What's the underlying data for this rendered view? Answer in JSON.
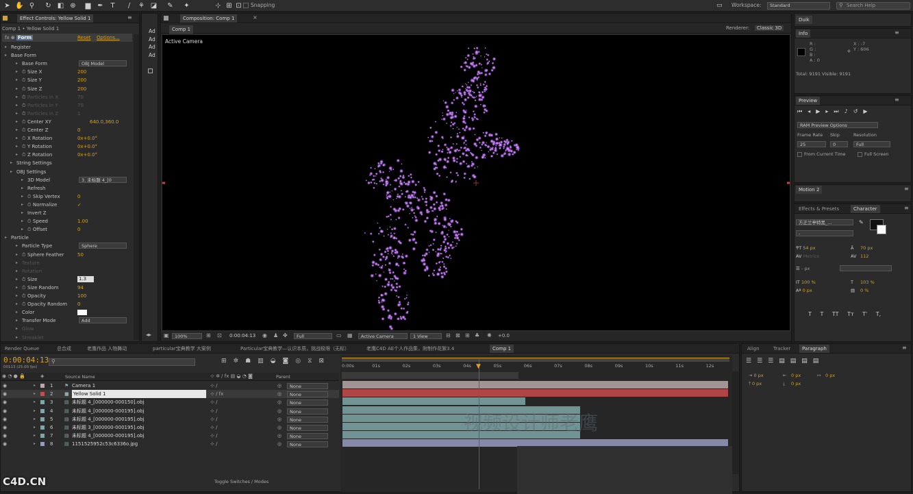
{
  "toolbar": {
    "snapping_label": "Snapping",
    "workspace_label": "Workspace:",
    "workspace_value": "Standard",
    "search_placeholder": "Search Help"
  },
  "effect_controls": {
    "tab_label": "Effect Controls: Yellow Solid 1",
    "breadcrumb": "Comp 1 • Yellow Solid 1",
    "effect_name": "Form",
    "reset_label": "Reset",
    "options_label": "Options...",
    "side_labels": [
      "Ad",
      "Ad",
      "Ad",
      "Ad"
    ],
    "rows": [
      {
        "label": "Register",
        "indent": 1,
        "value": "",
        "dim": false
      },
      {
        "label": "Base Form",
        "indent": 1,
        "value": "",
        "dim": false
      },
      {
        "label": "Base Form",
        "indent": 3,
        "value": "OBJ Model",
        "dd": true,
        "dim": false
      },
      {
        "label": "Size X",
        "indent": 3,
        "value": "200",
        "dim": false
      },
      {
        "label": "Size Y",
        "indent": 3,
        "value": "200",
        "dim": false
      },
      {
        "label": "Size Z",
        "indent": 3,
        "value": "200",
        "dim": false
      },
      {
        "label": "Particles in X",
        "indent": 3,
        "value": "70",
        "dim": true
      },
      {
        "label": "Particles in Y",
        "indent": 3,
        "value": "70",
        "dim": true
      },
      {
        "label": "Particles in Z",
        "indent": 3,
        "value": "1",
        "dim": true
      },
      {
        "label": "Center XY",
        "indent": 3,
        "value": "640.0,360.0",
        "dim": false
      },
      {
        "label": "Center Z",
        "indent": 3,
        "value": "0",
        "dim": false
      },
      {
        "label": "X Rotation",
        "indent": 3,
        "value": "0x+0.0°",
        "dim": false
      },
      {
        "label": "Y Rotation",
        "indent": 3,
        "value": "0x+0.0°",
        "dim": false
      },
      {
        "label": "Z Rotation",
        "indent": 3,
        "value": "0x+0.0°",
        "dim": false
      },
      {
        "label": "String Settings",
        "indent": 2,
        "value": "",
        "dim": false
      },
      {
        "label": "OBJ Settings",
        "indent": 2,
        "value": "",
        "dim": false
      },
      {
        "label": "3D Model",
        "indent": 4,
        "value": "3. 未标题 4_[0",
        "dd": true,
        "dim": false
      },
      {
        "label": "Refresh",
        "indent": 4,
        "value": "",
        "dim": false
      },
      {
        "label": "Skip Vertex",
        "indent": 4,
        "value": "0",
        "dim": false
      },
      {
        "label": "Normalize",
        "indent": 4,
        "value": "✓",
        "dim": false
      },
      {
        "label": "Invert Z",
        "indent": 4,
        "value": "",
        "dim": false
      },
      {
        "label": "Speed",
        "indent": 4,
        "value": "1.00",
        "dim": false
      },
      {
        "label": "Offset",
        "indent": 4,
        "value": "0",
        "dim": false
      },
      {
        "label": "Particle",
        "indent": 1,
        "value": "",
        "dim": false
      },
      {
        "label": "Particle Type",
        "indent": 3,
        "value": "Sphere",
        "dd": true,
        "dim": false
      },
      {
        "label": "Sphere Feather",
        "indent": 3,
        "value": "50",
        "dim": false
      },
      {
        "label": "Texture",
        "indent": 3,
        "value": "",
        "dim": true
      },
      {
        "label": "Rotation",
        "indent": 3,
        "value": "",
        "dim": true
      },
      {
        "label": "Size",
        "indent": 3,
        "value": "1.3",
        "box": true,
        "dim": false
      },
      {
        "label": "Size Random",
        "indent": 3,
        "value": "94",
        "dim": false
      },
      {
        "label": "Opacity",
        "indent": 3,
        "value": "100",
        "dim": false
      },
      {
        "label": "Opacity Random",
        "indent": 3,
        "value": "0",
        "dim": false
      },
      {
        "label": "Color",
        "indent": 3,
        "value": "",
        "swatch": true,
        "dim": false
      },
      {
        "label": "Transfer Mode",
        "indent": 3,
        "value": "Add",
        "dd": true,
        "dim": false
      },
      {
        "label": "Glow",
        "indent": 3,
        "value": "",
        "dim": true
      },
      {
        "label": "Streaklet",
        "indent": 3,
        "value": "",
        "dim": true
      }
    ]
  },
  "composition": {
    "tab_label": "Composition: Comp 1",
    "sub_tab": "Comp 1",
    "renderer_label": "Renderer:",
    "renderer_value": "Classic 3D",
    "view_label": "Active Camera",
    "zoom": "100%",
    "timecode": "0:00:04:13",
    "resolution": "Full",
    "camera": "Active Camera",
    "views": "1 View",
    "exposure": "+0.0"
  },
  "right_panels": {
    "duik_tab": "Duik",
    "info_tab": "Info",
    "info_r": "R :",
    "info_g": "G :",
    "info_b": "B :",
    "info_a": "A : 0",
    "info_x": "X : -7",
    "info_y": "Y : 606",
    "info_total": "Total: 9191   Visible: 9191",
    "preview_tab": "Preview",
    "ram_preview": "RAM Preview Options",
    "frame_rate_label": "Frame Rate",
    "skip_label": "Skip",
    "resolution_label": "Resolution",
    "frame_rate_value": "25",
    "skip_value": "0",
    "resolution_value": "Full",
    "from_current": "From Current Time",
    "full_screen": "Full Screen",
    "motion_tab": "Motion 2",
    "effects_tab": "Effects & Presets",
    "character_tab": "Character",
    "font_value": "方正兰亭特黑_...",
    "font_style": "-",
    "font_size": "54 px",
    "leading": "70 px",
    "kerning": "Metrics",
    "tracking": "112",
    "stroke_width": "- px",
    "vscale": "100 %",
    "hscale": "103 %",
    "baseline": "0 px",
    "tsume": "0 %",
    "text_buttons": [
      "T",
      "T",
      "TT",
      "Tт",
      "T'",
      "T,"
    ]
  },
  "timeline": {
    "tabs": [
      "Render Queue",
      "总合成",
      "老鹰作品 人物舞动",
      "particular宝典教学 大案例",
      "Particular宝典教学—认识本质，挑战极限（无标）",
      "老鹰C4D AE个人作品集，附制作花絮3.4",
      "Comp 1"
    ],
    "timecode": "0:00:04:13",
    "frame_info": "00113 (25.00 fps)",
    "col_source": "Source Name",
    "col_parent": "Parent",
    "ruler": [
      "0:00s",
      "01s",
      "02s",
      "03s",
      "04s",
      "05s",
      "06s",
      "07s",
      "08s",
      "09s",
      "10s",
      "11s",
      "12s"
    ],
    "layers": [
      {
        "num": "1",
        "name": "Camera 1",
        "parent": "None",
        "color": "#b8a8a8"
      },
      {
        "num": "2",
        "name": "Yellow Solid 1",
        "parent": "None",
        "color": "#c94b4b"
      },
      {
        "num": "3",
        "name": "未标题 4_[000000-000150].obj",
        "parent": "None",
        "color": "#7fa7a7"
      },
      {
        "num": "4",
        "name": "未标题 4_[000000-000195].obj",
        "parent": "None",
        "color": "#7fa7a7"
      },
      {
        "num": "5",
        "name": "未标题 4_[000000-000195].obj",
        "parent": "None",
        "color": "#7fa7a7"
      },
      {
        "num": "6",
        "name": "未标题 3_[000000-000195].obj",
        "parent": "None",
        "color": "#7fa7a7"
      },
      {
        "num": "7",
        "name": "未标题 4_[000000-000195].obj",
        "parent": "None",
        "color": "#7fa7a7"
      },
      {
        "num": "8",
        "name": "1151525952c53c6336o.jpg",
        "parent": "None",
        "color": "#9a9ac0"
      }
    ],
    "toggle_label": "Toggle Switches / Modes",
    "watermark": "视频设计师老鹰",
    "site_watermark": "C4D.CN"
  },
  "right_lower": {
    "align_tab": "Align",
    "tracker_tab": "Tracker",
    "paragraph_tab": "Paragraph",
    "indent_values": [
      "0 px",
      "0 px",
      "0 px",
      "0 px",
      "0 px"
    ]
  },
  "colors": {
    "accent": "#d6a21c",
    "panel": "#2b2b2b",
    "playhead": "#d03030"
  }
}
